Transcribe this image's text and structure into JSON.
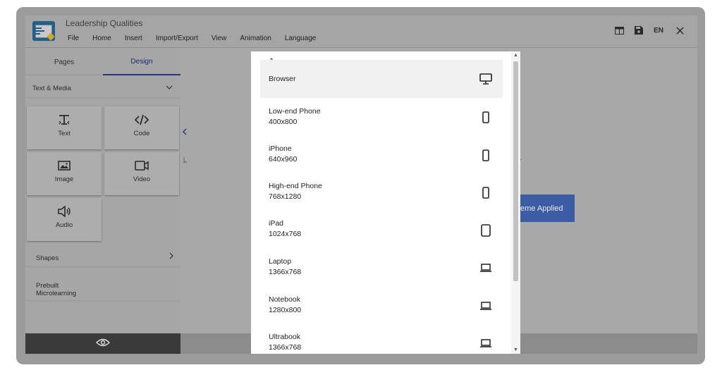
{
  "app": {
    "title": "Leadership Qualities",
    "menu": [
      "File",
      "Home",
      "Insert",
      "Import/Export",
      "View",
      "Animation",
      "Language"
    ],
    "language": "EN"
  },
  "sidebar": {
    "tabs": [
      "Pages",
      "Design"
    ],
    "active_tab": "Design",
    "section_dropdown": "Text & Media",
    "tiles": [
      {
        "label": "Text",
        "icon": "text-icon"
      },
      {
        "label": "Code",
        "icon": "code-icon"
      },
      {
        "label": "Image",
        "icon": "image-icon"
      },
      {
        "label": "Video",
        "icon": "video-icon"
      },
      {
        "label": "Audio",
        "icon": "audio-icon"
      }
    ],
    "shapes": "Shapes",
    "prebuilt": "Prebuilt Microlearning"
  },
  "canvas": {
    "button_text": "eme Applied"
  },
  "devices": [
    {
      "name": "Browser",
      "resolution": "",
      "icon": "desktop-icon"
    },
    {
      "name": "Low-end Phone",
      "resolution": "400x800",
      "icon": "phone-icon"
    },
    {
      "name": "iPhone",
      "resolution": "640x960",
      "icon": "phone-icon"
    },
    {
      "name": "High-end Phone",
      "resolution": "768x1280",
      "icon": "phone-icon"
    },
    {
      "name": "iPad",
      "resolution": "1024x768",
      "icon": "tablet-icon"
    },
    {
      "name": "Laptop",
      "resolution": "1366x768",
      "icon": "laptop-icon"
    },
    {
      "name": "Notebook",
      "resolution": "1280x800",
      "icon": "laptop-icon"
    },
    {
      "name": "Ultrabook",
      "resolution": "1366x768",
      "icon": "laptop-icon"
    }
  ],
  "selected_device": "Browser",
  "colors": {
    "accent": "#243680",
    "button": "#3c5ca3"
  }
}
